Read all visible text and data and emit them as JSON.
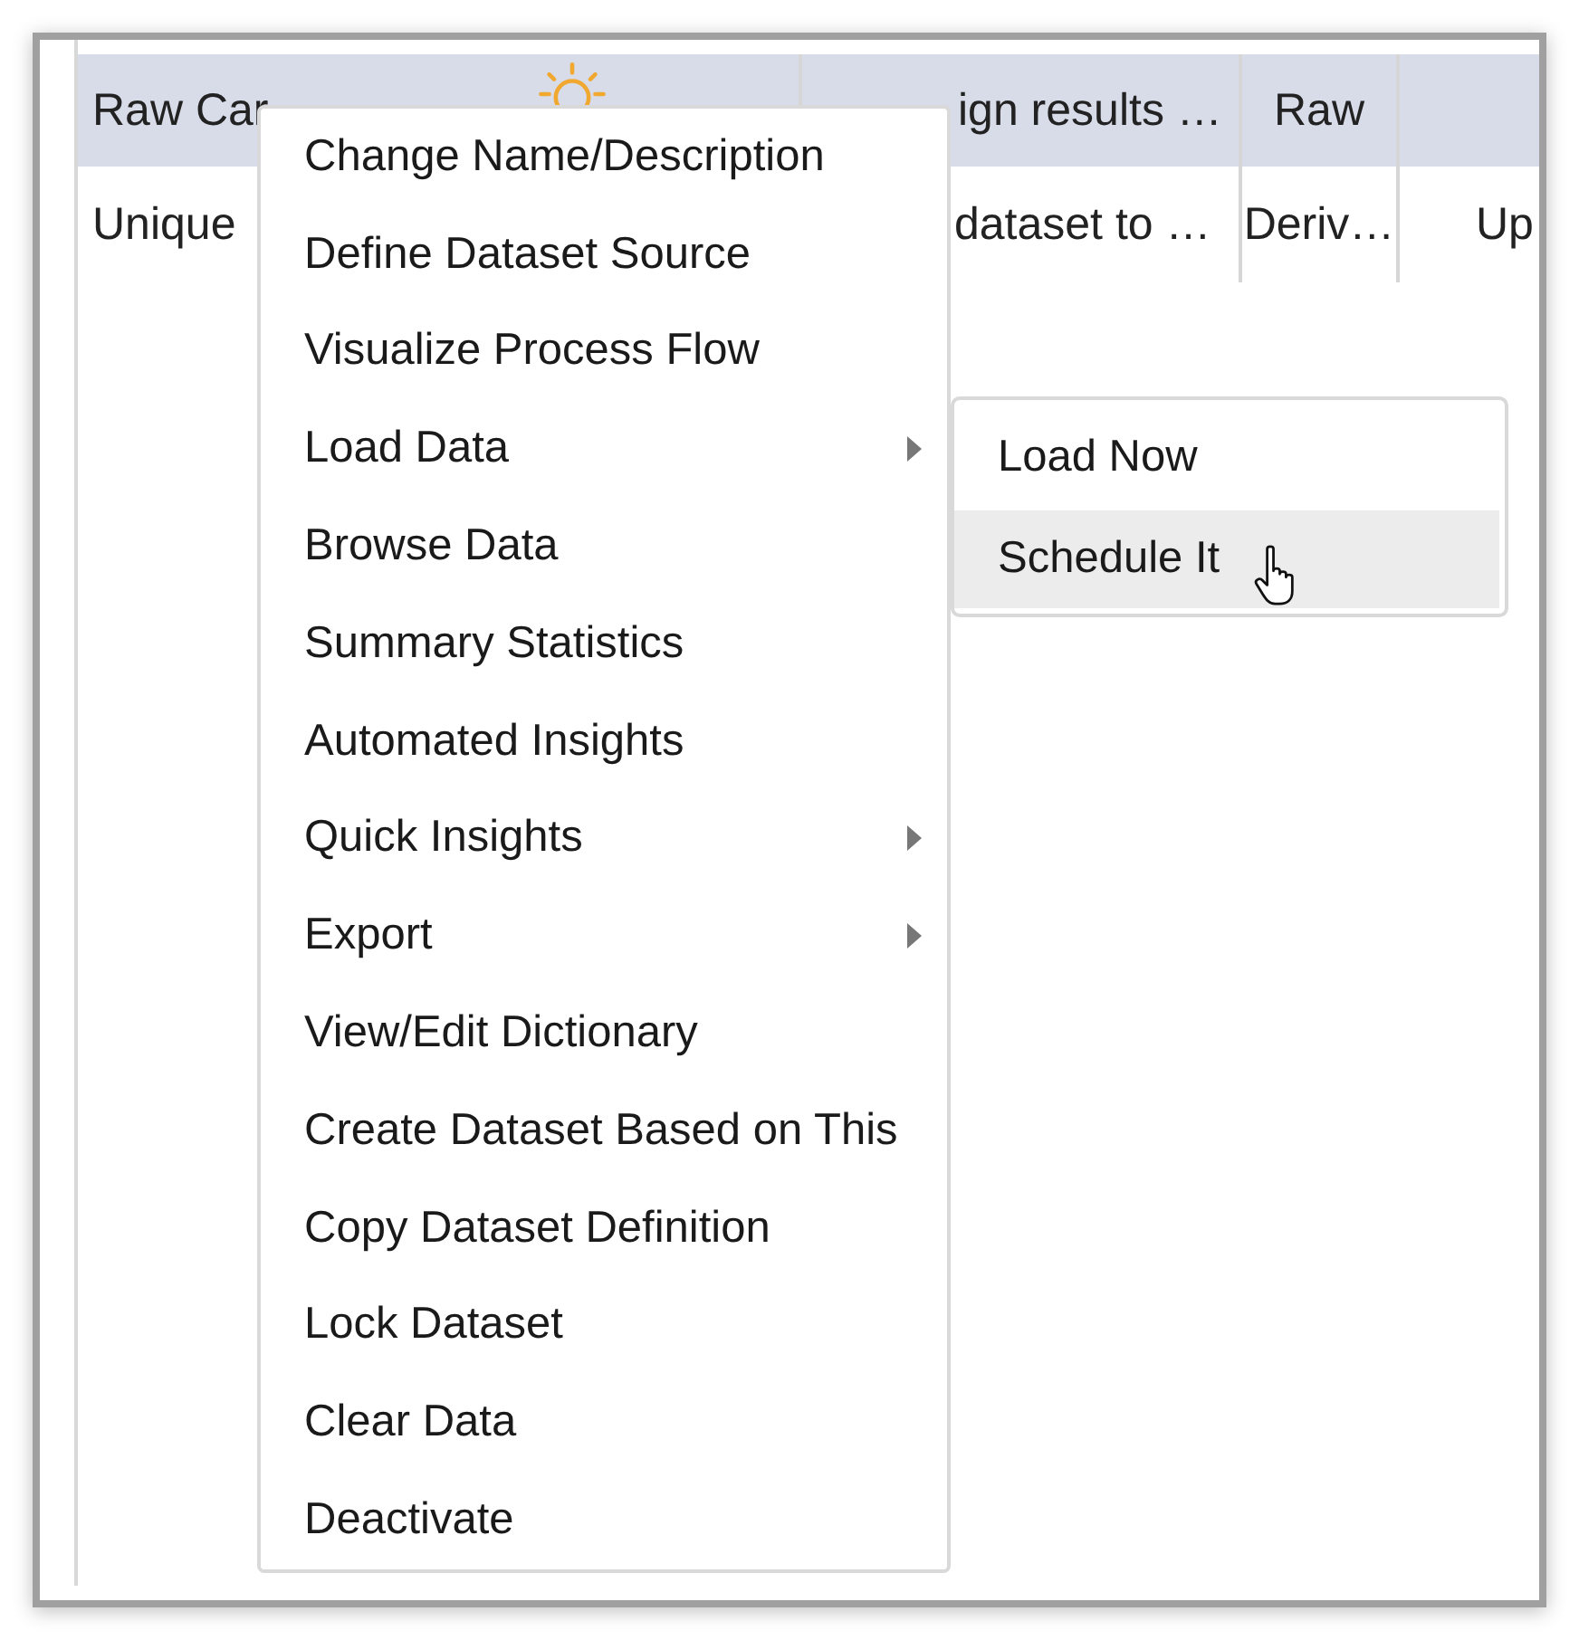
{
  "table": {
    "columns": [
      {
        "label": "Raw Car"
      },
      {
        "label": "ign results …"
      },
      {
        "label": "Raw"
      }
    ],
    "rows": [
      [
        "Unique",
        "dataset to …",
        "Deriv…",
        "Up"
      ]
    ]
  },
  "menu": {
    "items": [
      {
        "label": "Change Name/Description",
        "kind": "plain"
      },
      {
        "label": "Define Dataset Source",
        "kind": "plain"
      },
      {
        "label": "Visualize Process Flow",
        "kind": "plain"
      },
      {
        "label": "Load Data",
        "kind": "submenu",
        "items": [
          {
            "label": "Load Now",
            "selected": false
          },
          {
            "label": "Schedule It",
            "selected": true
          }
        ]
      },
      {
        "label": "Browse Data",
        "kind": "plain"
      },
      {
        "label": "Summary Statistics",
        "kind": "plain"
      },
      {
        "label": "Automated Insights",
        "kind": "plain"
      },
      {
        "label": "Quick Insights",
        "kind": "submenu"
      },
      {
        "label": "Export",
        "kind": "submenu"
      },
      {
        "label": "View/Edit Dictionary",
        "kind": "plain"
      },
      {
        "label": "Create Dataset Based on This",
        "kind": "plain"
      },
      {
        "label": "Copy Dataset Definition",
        "kind": "plain"
      },
      {
        "label": "Lock Dataset",
        "kind": "plain"
      },
      {
        "label": "Clear Data",
        "kind": "plain"
      },
      {
        "label": "Deactivate",
        "kind": "plain"
      }
    ]
  }
}
